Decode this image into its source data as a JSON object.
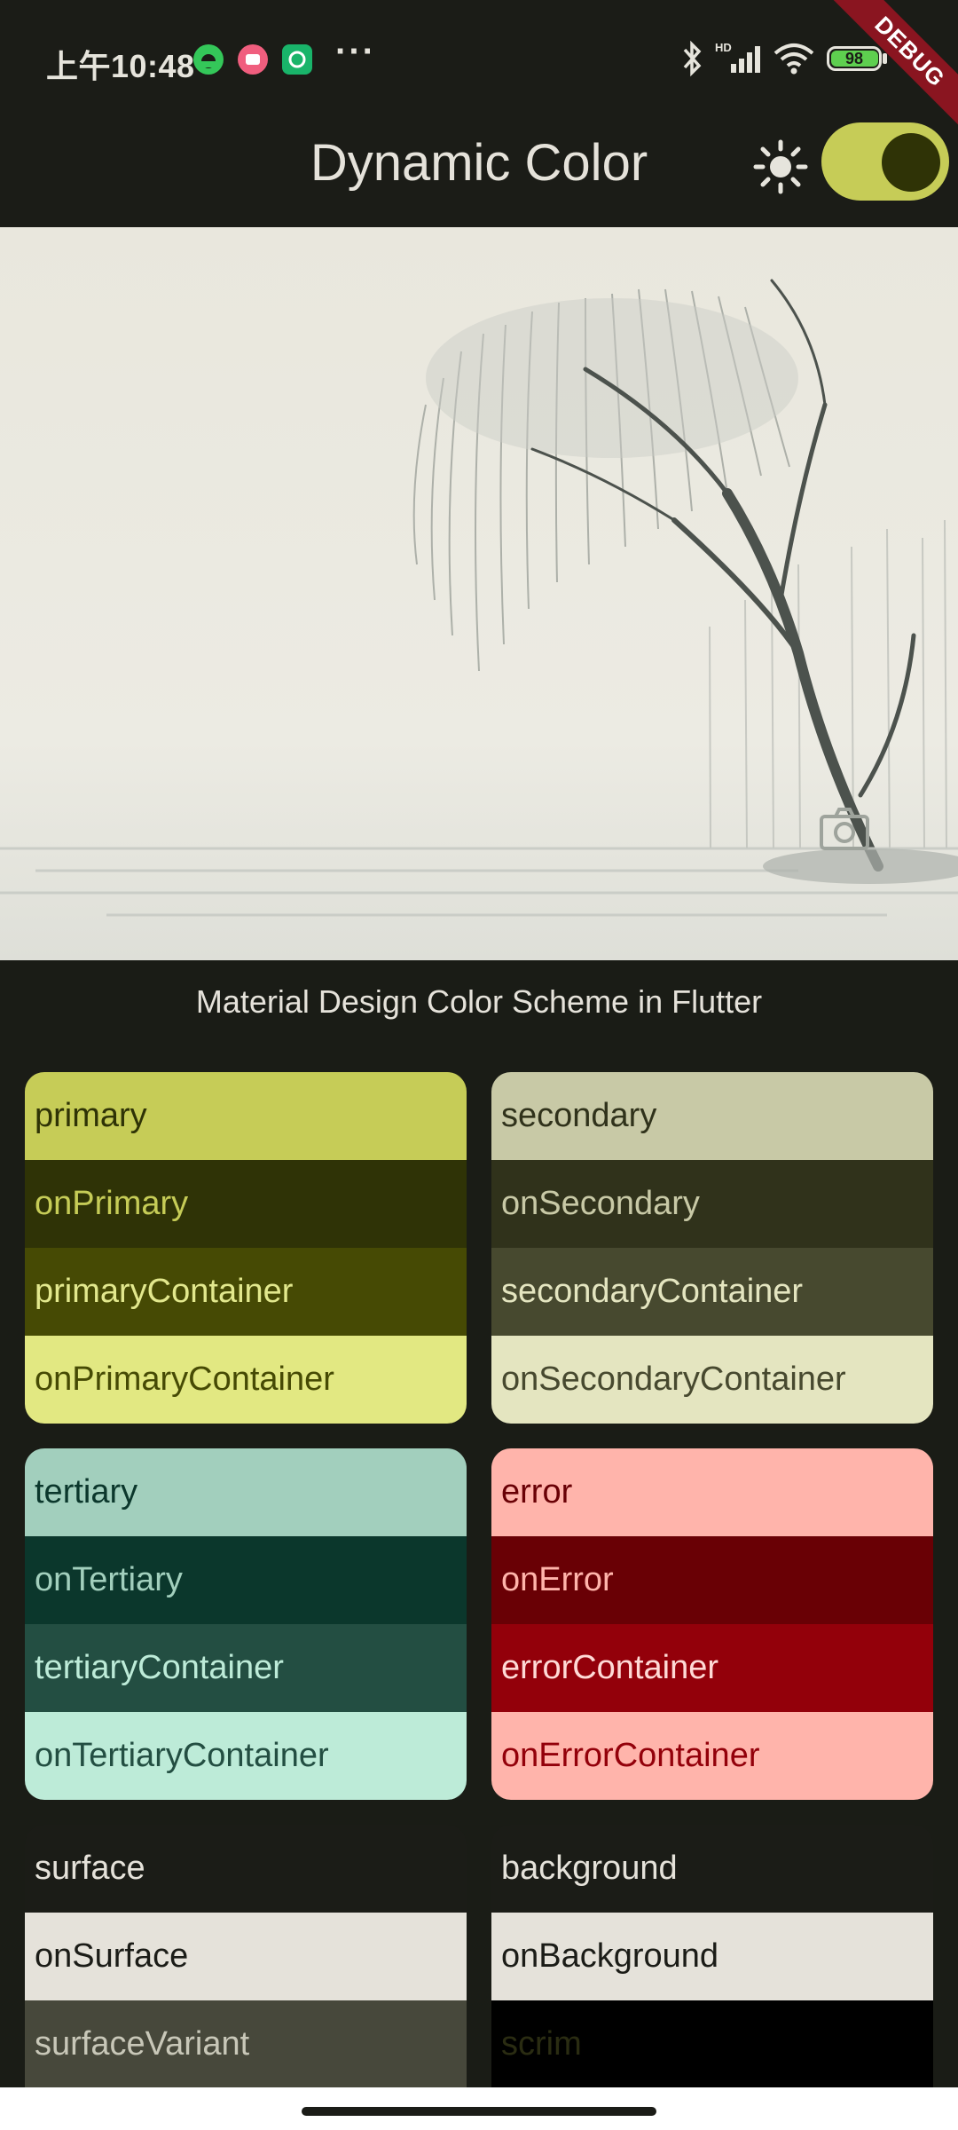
{
  "status_bar": {
    "time": "上午10:48",
    "more": "···",
    "battery_level": "98",
    "app_icons": [
      "android-app-icon",
      "bilibili-app-icon",
      "chat-app-icon"
    ]
  },
  "app_bar": {
    "title": "Dynamic Color",
    "theme_toggle_on": true,
    "debug_banner": "DEBUG"
  },
  "caption": "Material Design Color Scheme in Flutter",
  "colors": {
    "accent": "#c6cc57",
    "background": "#1a1c16"
  },
  "cards": {
    "primary_group": [
      "primary",
      "onPrimary",
      "primaryContainer",
      "onPrimaryContainer"
    ],
    "secondary_group": [
      "secondary",
      "onSecondary",
      "secondaryContainer",
      "onSecondaryContainer"
    ],
    "tertiary_group": [
      "tertiary",
      "onTertiary",
      "tertiaryContainer",
      "onTertiaryContainer"
    ],
    "error_group": [
      "error",
      "onError",
      "errorContainer",
      "onErrorContainer"
    ],
    "surface_group": [
      "surface",
      "onSurface",
      "surfaceVariant"
    ],
    "background_group": [
      "background",
      "onBackground",
      "scrim"
    ]
  }
}
